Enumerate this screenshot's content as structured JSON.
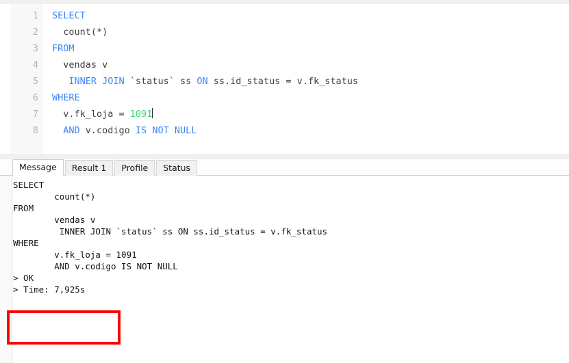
{
  "editor": {
    "line_numbers": [
      "1",
      "2",
      "3",
      "4",
      "5",
      "6",
      "7",
      "8"
    ],
    "lines": [
      {
        "n": "1",
        "tokens": [
          {
            "t": "SELECT",
            "c": "kw"
          }
        ]
      },
      {
        "n": "2",
        "tokens": [
          {
            "t": "  count(*)",
            "c": "plain"
          }
        ]
      },
      {
        "n": "3",
        "tokens": [
          {
            "t": "FROM",
            "c": "kw"
          }
        ]
      },
      {
        "n": "4",
        "tokens": [
          {
            "t": "  vendas v",
            "c": "plain"
          }
        ]
      },
      {
        "n": "5",
        "tokens": [
          {
            "t": "   ",
            "c": "plain"
          },
          {
            "t": "INNER JOIN",
            "c": "kw"
          },
          {
            "t": " `status` ss ",
            "c": "plain"
          },
          {
            "t": "ON",
            "c": "kw"
          },
          {
            "t": " ss.id_status = v.fk_status",
            "c": "plain"
          }
        ]
      },
      {
        "n": "6",
        "tokens": [
          {
            "t": "WHERE",
            "c": "kw"
          }
        ]
      },
      {
        "n": "7",
        "tokens": [
          {
            "t": "  v.fk_loja = ",
            "c": "plain"
          },
          {
            "t": "1091",
            "c": "num"
          }
        ],
        "caret": true
      },
      {
        "n": "8",
        "tokens": [
          {
            "t": "  ",
            "c": "plain"
          },
          {
            "t": "AND",
            "c": "kw"
          },
          {
            "t": " v.codigo ",
            "c": "plain"
          },
          {
            "t": "IS NOT NULL",
            "c": "kw"
          }
        ]
      }
    ],
    "full_text": "SELECT\n  count(*)\nFROM\n  vendas v\n   INNER JOIN `status` ss ON ss.id_status = v.fk_status\nWHERE\n  v.fk_loja = 1091\n  AND v.codigo IS NOT NULL"
  },
  "tabs": [
    {
      "label": "Message",
      "active": true
    },
    {
      "label": "Result 1",
      "active": false
    },
    {
      "label": "Profile",
      "active": false
    },
    {
      "label": "Status",
      "active": false
    }
  ],
  "message": {
    "lines": [
      "SELECT",
      "        count(*)",
      "FROM",
      "        vendas v",
      "         INNER JOIN `status` ss ON ss.id_status = v.fk_status",
      "WHERE",
      "        v.fk_loja = 1091",
      "        AND v.codigo IS NOT NULL",
      "> OK",
      "> Time: 7,925s"
    ],
    "status_ok": "> OK",
    "status_time": "> Time: 7,925s"
  },
  "annotation": {
    "type": "red-rectangle-highlight",
    "color": "#fe0000",
    "targets": [
      "> OK",
      "> Time: 7,925s"
    ]
  },
  "colors": {
    "keyword": "#3b86f7",
    "number": "#2fd96c",
    "code_text": "#3f3f3f",
    "gutter_bg": "#f8f8f8",
    "gutter_text": "#b3b3b3",
    "message_text": "#111111",
    "highlight": "#fe0000"
  }
}
